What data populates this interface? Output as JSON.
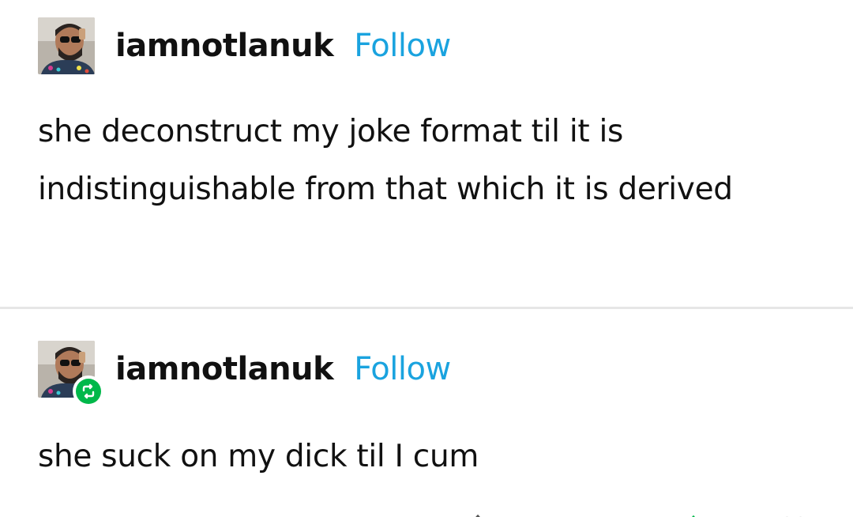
{
  "posts": [
    {
      "username": "iamnotlanuk",
      "follow_label": "Follow",
      "text": "she deconstruct my joke format til it is indistinguishable from that which it is derived",
      "avatar_icon": "user-avatar",
      "reblog": false
    },
    {
      "username": "iamnotlanuk",
      "follow_label": "Follow",
      "text": "she suck on my dick til I cum",
      "avatar_icon": "user-avatar",
      "reblog": true,
      "reblog_icon": "reblog-icon"
    }
  ],
  "colors": {
    "follow": "#1aa3df",
    "reblog_badge": "#00b84a",
    "text": "#111111",
    "divider": "#e6e6e6"
  },
  "footer": {
    "icons": [
      "share-icon",
      "reply-icon",
      "reblog-icon",
      "like-icon"
    ]
  }
}
